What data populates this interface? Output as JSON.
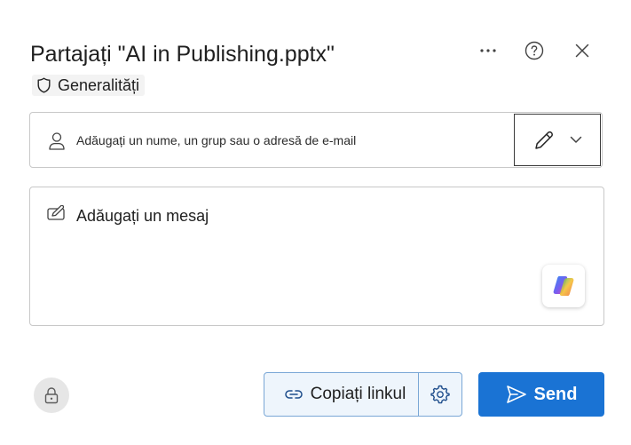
{
  "dialog": {
    "title": "Partajați \"AI in Publishing.pptx\"",
    "header_icons": {
      "more": "more-horizontal-icon",
      "help": "help-circle-icon",
      "close": "close-icon"
    }
  },
  "sensitivity": {
    "label": "Generalități",
    "icon": "shield-icon"
  },
  "recipients": {
    "placeholder": "Adăugați un nume, un grup sau o adresă de e-mail",
    "value": "",
    "icon": "person-icon",
    "permission_icon": "pencil-icon",
    "dropdown_icon": "chevron-down-icon"
  },
  "message": {
    "placeholder": "Adăugați un mesaj",
    "value": "",
    "icon": "compose-icon",
    "copilot_icon": "copilot-icon"
  },
  "footer": {
    "lock_icon": "lock-icon",
    "copy_link_label": "Copiați linkul",
    "copy_link_icon": "link-icon",
    "link_settings_icon": "gear-icon",
    "send_label": "Send",
    "send_icon": "send-icon"
  },
  "colors": {
    "accent": "#1a73d4",
    "copy_bg": "#eef5fc",
    "copy_border": "#7aa7d6",
    "lock_bg": "#e6e6e6"
  }
}
